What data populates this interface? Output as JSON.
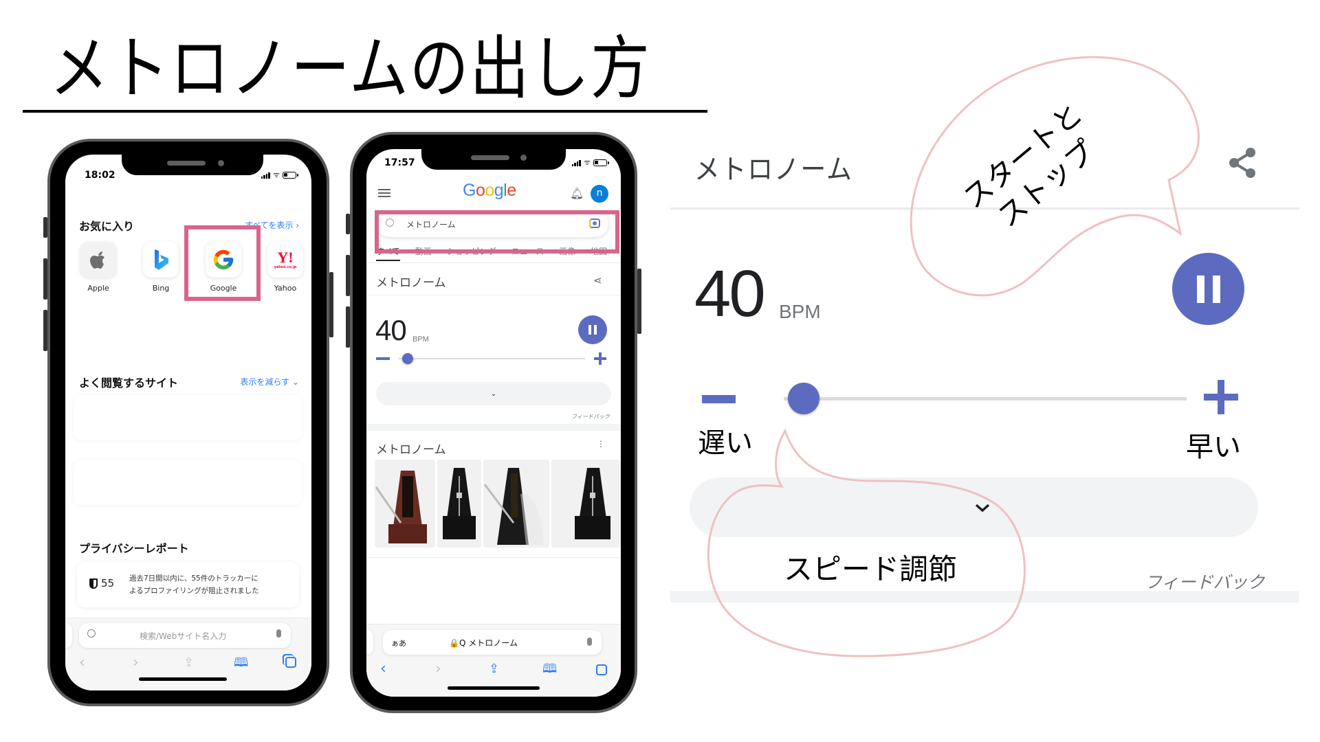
{
  "title": "メトロノームの出し方",
  "colors": {
    "highlight": "#d9648e",
    "bubble_stroke": "#eec1c1",
    "metronome_accent": "#5c6bc0",
    "link_blue": "#2f7cf6"
  },
  "phone1": {
    "status_time": "18:02",
    "favorites": {
      "title": "お気に入り",
      "show_all": "すべてを表示 ›",
      "items": [
        {
          "label": "Apple",
          "icon": "apple-icon"
        },
        {
          "label": "Bing",
          "icon": "bing-icon"
        },
        {
          "label": "Google",
          "icon": "google-g-icon"
        },
        {
          "label": "Yahoo",
          "icon": "yahoo-icon",
          "icon_text": "Y!",
          "icon_sub": "yahoo.co.jp"
        }
      ]
    },
    "frequent": {
      "title": "よく閲覧するサイト",
      "toggle": "表示を減らす ⌄"
    },
    "privacy": {
      "title": "プライバシーレポート",
      "count": "55",
      "text_line1": "過去7日間以内に、55件のトラッカーに",
      "text_line2": "よるプロファイリングが阻止されました"
    },
    "address_bar": {
      "placeholder": "検索/Webサイト名入力"
    },
    "toolbar": [
      "back-icon",
      "forward-icon",
      "share-icon",
      "bookmarks-icon",
      "tabs-icon"
    ]
  },
  "phone2": {
    "status_time": "17:57",
    "google_logo": [
      "G",
      "o",
      "o",
      "g",
      "l",
      "e"
    ],
    "avatar_letter": "n",
    "search_query": "メトロノーム",
    "tabs": [
      "すべて",
      "動画",
      "ショッピング",
      "ニュース",
      "画像",
      "地図"
    ],
    "widget": {
      "title": "メトロノーム",
      "bpm": "40",
      "bpm_unit": "BPM",
      "slider_fraction": 0.05,
      "feedback": "フィードバック"
    },
    "images_section": {
      "title": "メトロノーム",
      "images": [
        "metronome-wood",
        "metronome-black-yamaha",
        "metronome-black-open",
        "metronome-black-yamaha-2"
      ]
    },
    "address_bar": {
      "aa": "ぁあ",
      "url": "🔒Q メトロノーム"
    }
  },
  "panel": {
    "title": "メトロノーム",
    "bpm": "40",
    "bpm_unit": "BPM",
    "slider_fraction": 0.05,
    "slow_label": "遅い",
    "fast_label": "早い",
    "feedback": "フィードバック",
    "annotation_start_stop_line1": "スタートと",
    "annotation_start_stop_line2": "ストップ",
    "annotation_speed": "スピード調節"
  }
}
